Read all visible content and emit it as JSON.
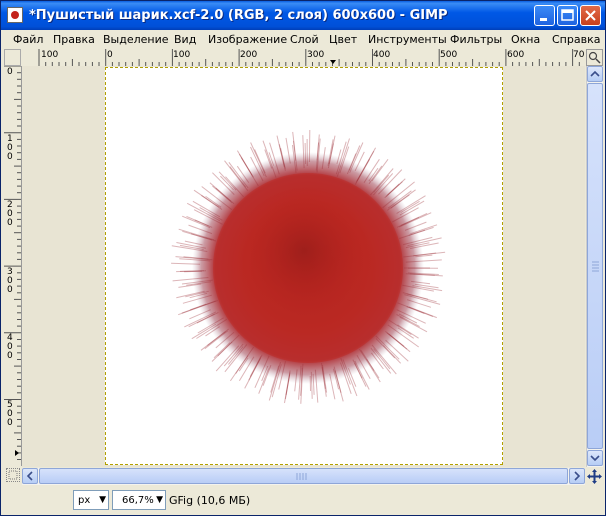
{
  "window": {
    "title": "*Пушистый шарик.xcf-2.0 (RGB, 2 слоя) 600x600 - GIMP"
  },
  "menu": [
    {
      "label": "Файл"
    },
    {
      "label": "Правка"
    },
    {
      "label": "Выделение"
    },
    {
      "label": "Вид"
    },
    {
      "label": "Изображение"
    },
    {
      "label": "Слой"
    },
    {
      "label": "Цвет"
    },
    {
      "label": "Инструменты"
    },
    {
      "label": "Фильтры"
    },
    {
      "label": "Окна"
    },
    {
      "label": "Справка"
    }
  ],
  "hruler_labels": [
    "100",
    "0",
    "100",
    "200",
    "300",
    "400",
    "500",
    "600",
    "70"
  ],
  "vruler_labels": [
    "0",
    "100",
    "200",
    "300",
    "400",
    "500"
  ],
  "status": {
    "unit": "px",
    "zoom": "66,7%",
    "info": "GFig (10,6 МБ)"
  },
  "icons": {
    "app": "gimp-icon",
    "minimize": "minimize-icon",
    "maximize": "maximize-icon",
    "close": "close-icon",
    "navigate": "navigate-icon",
    "quickmask": "quick-mask-icon"
  },
  "colors": {
    "ball": "#c4231b",
    "titlebar": "#0058e6",
    "selection": "#b3a000"
  }
}
